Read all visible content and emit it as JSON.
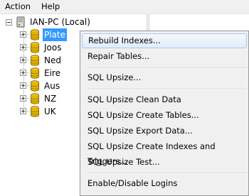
{
  "menubar": {
    "items": [
      {
        "label": "Action"
      },
      {
        "label": "Help"
      }
    ]
  },
  "tree": {
    "root": {
      "label": "IAN-PC (Local)"
    },
    "children": [
      {
        "label": "Plate",
        "selected": true
      },
      {
        "label": "Joos"
      },
      {
        "label": "Ned"
      },
      {
        "label": "Eire"
      },
      {
        "label": "Aus"
      },
      {
        "label": "NZ"
      },
      {
        "label": "UK"
      }
    ]
  },
  "context_menu": {
    "items": [
      {
        "label": "Rebuild Indexes...",
        "hover": true
      },
      {
        "label": "Repair Tables..."
      },
      {
        "label": "SQL Upsize..."
      },
      {
        "label": "SQL Upsize Clean Data"
      },
      {
        "label": "SQL Upsize Create Tables..."
      },
      {
        "label": "SQL Upsize Export Data..."
      },
      {
        "label": "SQL Upsize Create Indexes and Triggers..."
      },
      {
        "label": "SQL Upsize Test..."
      },
      {
        "label": "Enable/Disable Logins"
      }
    ]
  },
  "colors": {
    "selection": "#3399ff",
    "db_icon": "#e0b400",
    "menu_bg": "#f0f0f0"
  }
}
